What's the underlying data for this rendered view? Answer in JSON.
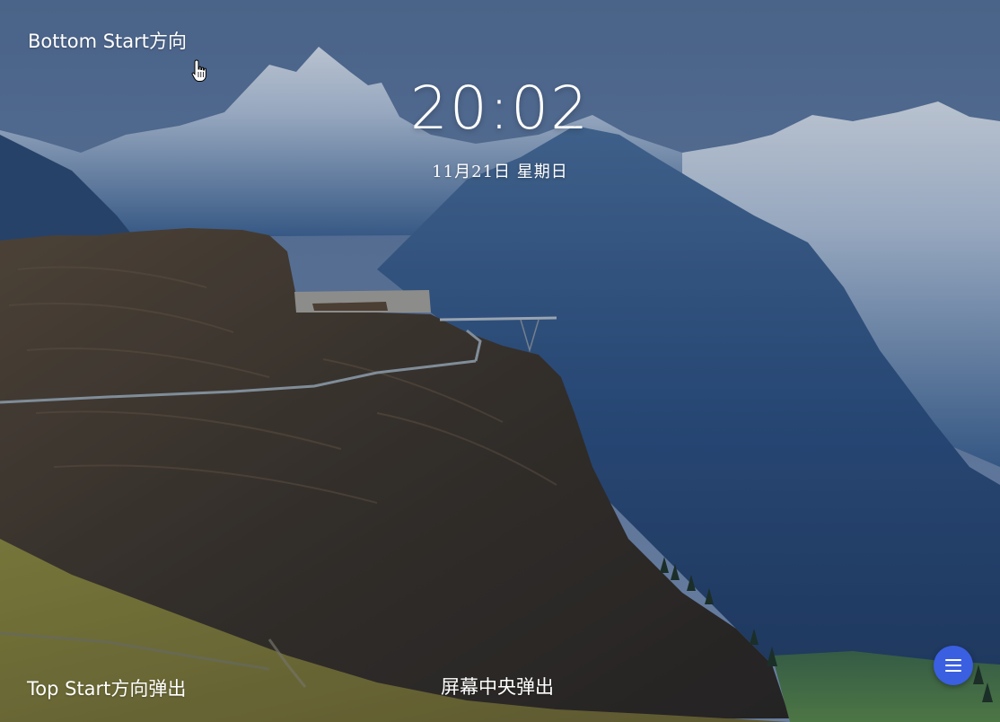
{
  "corners": {
    "top_left_label": "Bottom Start方向",
    "bottom_left_label": "Top Start方向弹出",
    "bottom_center_label": "屏幕中央弹出"
  },
  "lock_screen": {
    "time": "20:02",
    "date": "11月21日 星期日"
  },
  "fab": {
    "icon": "menu-icon",
    "color": "#3a5fe0"
  },
  "wallpaper": {
    "description_colors": {
      "sky": "#6d88b0",
      "mountain_shadow": "#2f5182",
      "cliff": "#3a3128",
      "grass": "#8f8a3a"
    }
  }
}
